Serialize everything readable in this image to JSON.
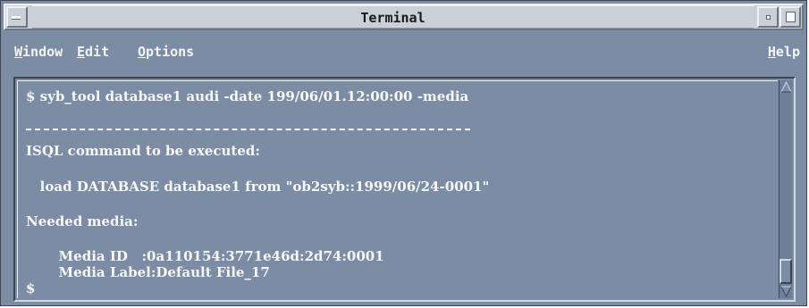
{
  "window": {
    "title": "Terminal"
  },
  "menubar": {
    "window_mnemonic": "W",
    "window_rest": "indow",
    "edit_mnemonic": "E",
    "edit_rest": "dit",
    "options_mnemonic": "O",
    "options_rest": "ptions",
    "help_mnemonic": "H",
    "help_rest": "elp"
  },
  "terminal": {
    "lines": [
      "$ syb_tool database1 audi -date 199/06/01.12:00:00 -media",
      "ISQL command to be executed:",
      "   load DATABASE database1 from \"ob2syb::1999/06/24-0001\"",
      "Needed media:",
      "       Media ID   :0a110154:3771e46d:2d74:0001",
      "       Media Label:Default File_17",
      "$"
    ]
  },
  "colors": {
    "background": "#7c8ca4",
    "text": "#f7f8fa",
    "titlebar": "#c9d0d8"
  }
}
